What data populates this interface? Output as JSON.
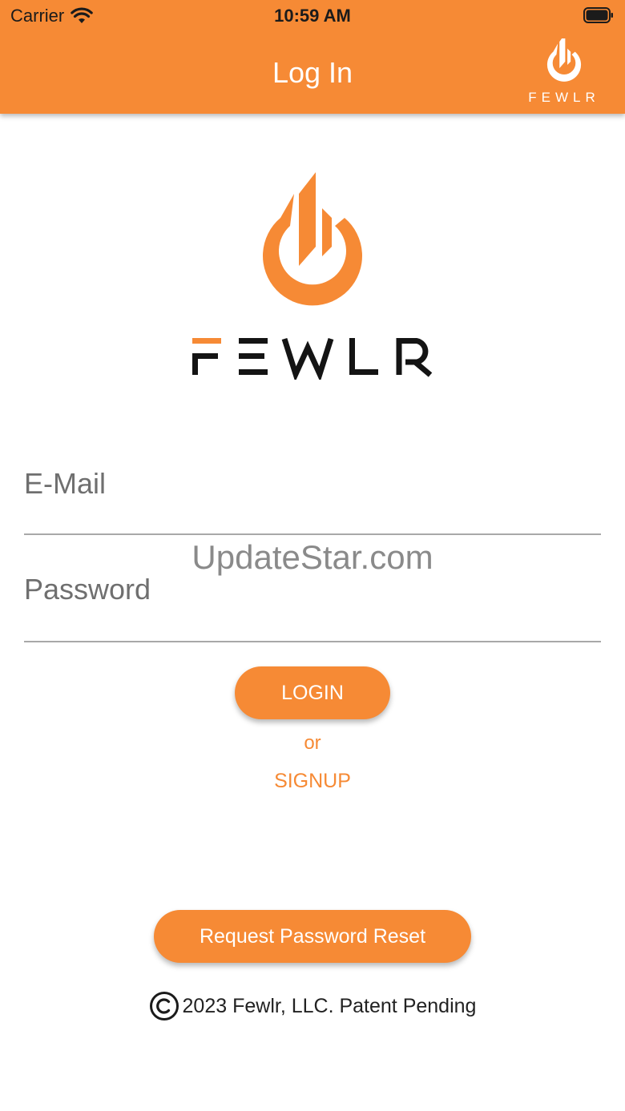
{
  "status_bar": {
    "carrier": "Carrier",
    "time": "10:59 AM",
    "wifi_icon": "wifi-icon",
    "battery_icon": "battery-icon"
  },
  "header": {
    "title": "Log In",
    "logo_text": "FEWLR",
    "background_color": "#F68A35"
  },
  "brand": {
    "wordmark": "FEWLR",
    "flame_icon": "flame-logo-icon",
    "accent_color": "#F68A35"
  },
  "form": {
    "email_placeholder": "E-Mail",
    "email_value": "",
    "password_placeholder": "Password",
    "password_value": ""
  },
  "watermark": "UpdateStar.com",
  "actions": {
    "login_label": "LOGIN",
    "or_label": "or",
    "signup_label": "SIGNUP",
    "reset_label": "Request Password Reset"
  },
  "footer": {
    "copyright_icon": "copyright-icon",
    "copyright_text": "2023 Fewlr, LLC. Patent Pending"
  }
}
